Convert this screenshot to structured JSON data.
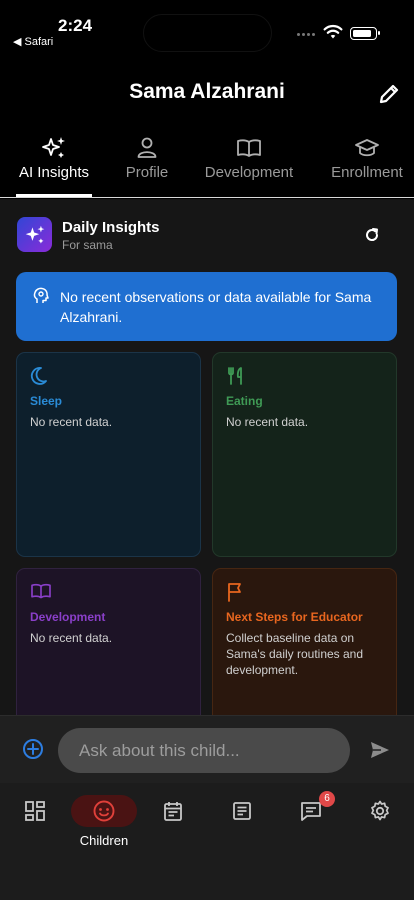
{
  "status_bar": {
    "time": "2:24",
    "back_app": "◀ Safari"
  },
  "header": {
    "title": "Sama Alzahrani"
  },
  "tabs": [
    {
      "label": "AI Insights",
      "icon": "sparkles-icon",
      "active": true
    },
    {
      "label": "Profile",
      "icon": "person-icon",
      "active": false
    },
    {
      "label": "Development",
      "icon": "open-book-icon",
      "active": false
    },
    {
      "label": "Enrollment",
      "icon": "graduation-cap-icon",
      "active": false
    }
  ],
  "daily_insights": {
    "title": "Daily Insights",
    "subtitle": "For sama"
  },
  "banner": {
    "text": "No recent observations or data available for Sama Alzahrani."
  },
  "cards": [
    {
      "title": "Sleep",
      "body": "No recent data.",
      "icon": "moon-icon",
      "color": "#2a8bd6"
    },
    {
      "title": "Eating",
      "body": "No recent data.",
      "icon": "fork-knife-icon",
      "color": "#3f9a55"
    },
    {
      "title": "Development",
      "body": "No recent data.",
      "icon": "open-book-icon",
      "color": "#8a3fc9"
    },
    {
      "title": "Next Steps for Educator",
      "body": "Collect baseline data on Sama's daily routines and development.",
      "icon": "flag-icon",
      "color": "#e8661f"
    }
  ],
  "ask": {
    "placeholder": "Ask about this child..."
  },
  "bottom_nav": [
    {
      "name": "dashboard",
      "icon": "dashboard-icon",
      "label": ""
    },
    {
      "name": "children",
      "icon": "child-face-icon",
      "label": "Children",
      "active": true
    },
    {
      "name": "calendar",
      "icon": "calendar-icon",
      "label": ""
    },
    {
      "name": "reports",
      "icon": "document-icon",
      "label": ""
    },
    {
      "name": "messages",
      "icon": "chat-icon",
      "label": "",
      "badge": "6"
    },
    {
      "name": "settings",
      "icon": "gear-icon",
      "label": ""
    }
  ],
  "colors": {
    "accent_blue": "#1f6fd1",
    "active_red": "#e0403a"
  }
}
